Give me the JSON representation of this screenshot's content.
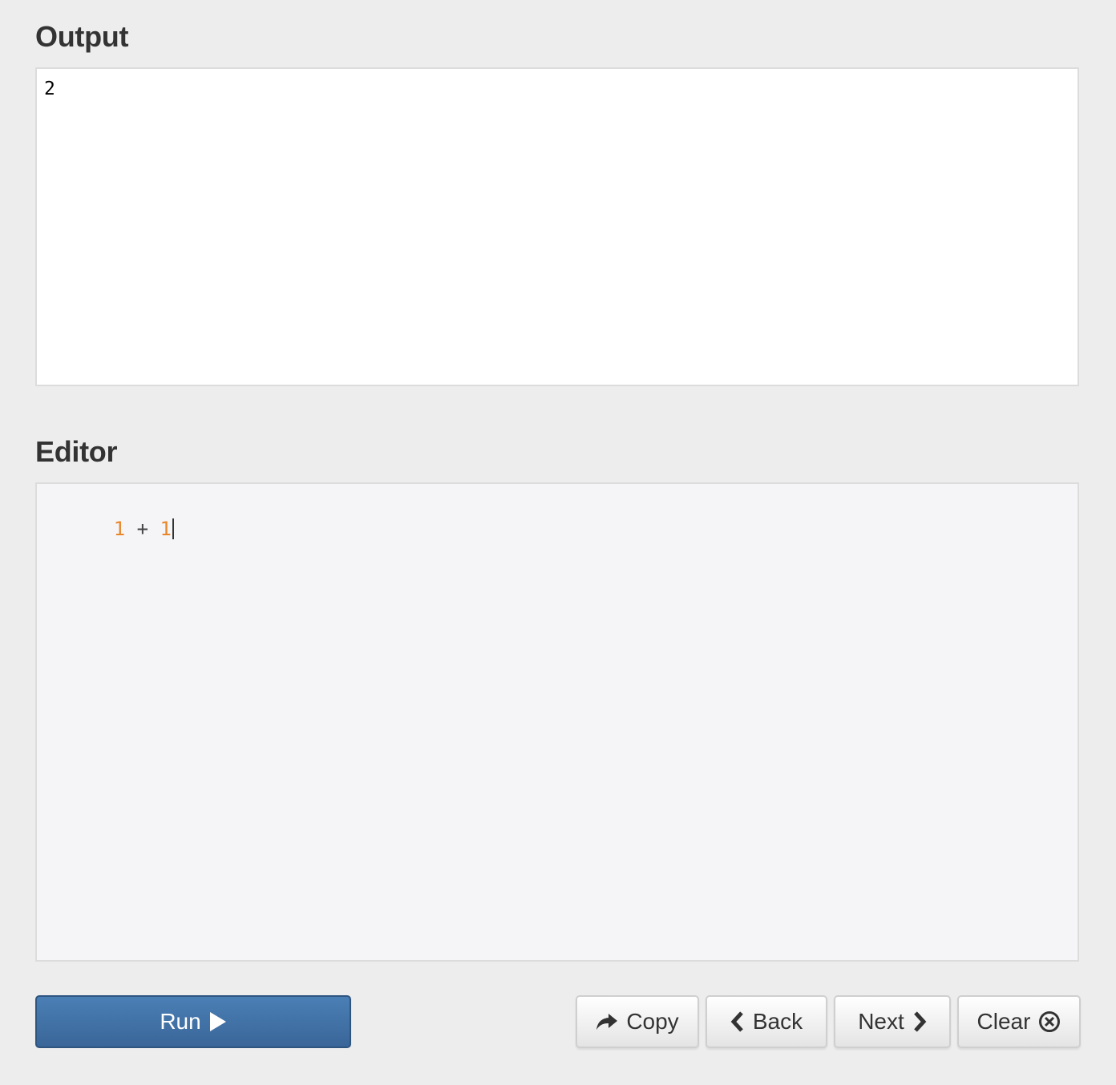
{
  "output": {
    "title": "Output",
    "text": "2"
  },
  "editor": {
    "title": "Editor",
    "code_tokens": [
      {
        "type": "number",
        "text": "1"
      },
      {
        "type": "operator",
        "text": " + "
      },
      {
        "type": "number",
        "text": "1"
      }
    ]
  },
  "buttons": {
    "run": {
      "label": "Run",
      "icon": "play-icon"
    },
    "copy": {
      "label": "Copy",
      "icon": "share-arrow-icon"
    },
    "back": {
      "label": "Back",
      "icon": "chevron-left-icon"
    },
    "next": {
      "label": "Next",
      "icon": "chevron-right-icon"
    },
    "clear": {
      "label": "Clear",
      "icon": "circle-x-icon"
    }
  },
  "colors": {
    "background": "#ededed",
    "primary_button": "#3f6ea3",
    "number_token": "#e8862a"
  }
}
